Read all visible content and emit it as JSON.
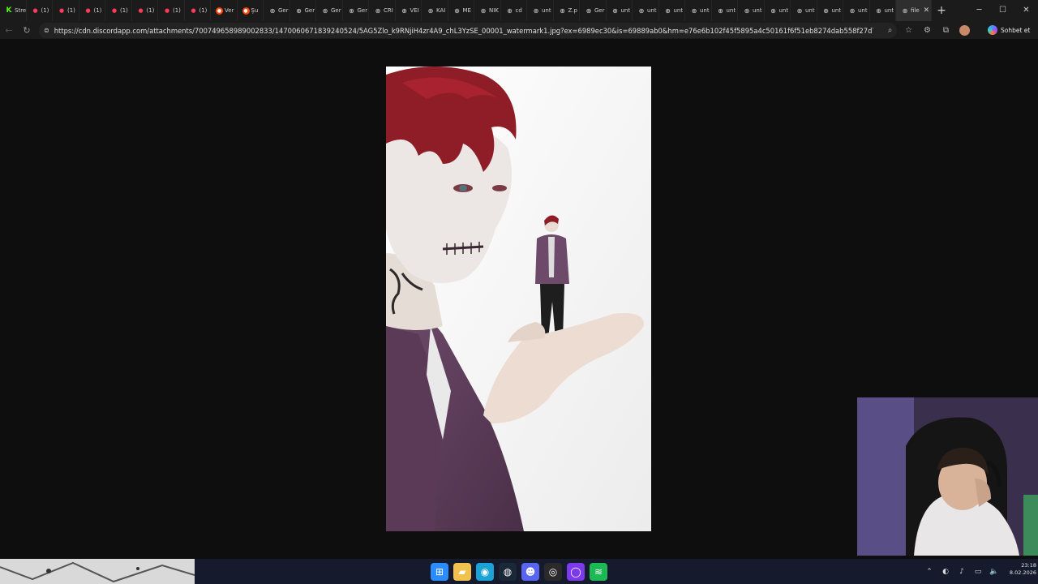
{
  "browser": {
    "tabs": [
      {
        "icon": "kick-icon",
        "label": "Stre"
      },
      {
        "icon": "youtube-icon",
        "label": "(1)"
      },
      {
        "icon": "youtube-icon",
        "label": "(1)"
      },
      {
        "icon": "youtube-icon",
        "label": "(1)"
      },
      {
        "icon": "youtube-icon",
        "label": "(1)"
      },
      {
        "icon": "youtube-icon",
        "label": "(1)"
      },
      {
        "icon": "youtube-icon",
        "label": "(1)"
      },
      {
        "icon": "youtube-icon",
        "label": "(1)"
      },
      {
        "icon": "reddit-icon",
        "label": "Ver"
      },
      {
        "icon": "reddit-icon",
        "label": "Şu"
      },
      {
        "icon": "globe-icon",
        "label": "Ger"
      },
      {
        "icon": "globe-icon",
        "label": "Ger"
      },
      {
        "icon": "globe-icon",
        "label": "Ger"
      },
      {
        "icon": "globe-icon",
        "label": "Ger"
      },
      {
        "icon": "globe-icon",
        "label": "CRI"
      },
      {
        "icon": "globe-icon",
        "label": "VEI"
      },
      {
        "icon": "globe-icon",
        "label": "KAI"
      },
      {
        "icon": "globe-icon",
        "label": "ME"
      },
      {
        "icon": "globe-icon",
        "label": "NIK"
      },
      {
        "icon": "globe-icon",
        "label": "cd"
      },
      {
        "icon": "globe-icon",
        "label": "unt"
      },
      {
        "icon": "globe-icon",
        "label": "Z.p"
      },
      {
        "icon": "globe-icon",
        "label": "Ger"
      },
      {
        "icon": "globe-icon",
        "label": "unt"
      },
      {
        "icon": "globe-icon",
        "label": "unt"
      },
      {
        "icon": "globe-icon",
        "label": "unt"
      },
      {
        "icon": "globe-icon",
        "label": "unt"
      },
      {
        "icon": "globe-icon",
        "label": "unt"
      },
      {
        "icon": "globe-icon",
        "label": "unt"
      },
      {
        "icon": "globe-icon",
        "label": "unt"
      },
      {
        "icon": "globe-icon",
        "label": "unt"
      },
      {
        "icon": "globe-icon",
        "label": "unt"
      },
      {
        "icon": "globe-icon",
        "label": "unt"
      },
      {
        "icon": "globe-icon",
        "label": "unt"
      }
    ],
    "active_tab": {
      "icon": "globe-icon",
      "label": "file"
    },
    "new_tab_label": "+",
    "url": "https://cdn.discordapp.com/attachments/700749658989002833/1470060671839240524/5AG5Zlo_k9RNjiH4zr4A9_chL3YzSE_00001_watermark1.jpg?ex=6989ec30&is=69889ab0&hm=e76e6b102f45f5895a4c50161f6f51eb8274dab558f27d776cbe404192f228e6&",
    "copilot_label": "Sohbet et"
  },
  "taskbar": {
    "apps": [
      {
        "name": "start-icon",
        "color": "#2b8cff"
      },
      {
        "name": "folder-icon",
        "color": "#f2c14e"
      },
      {
        "name": "edge-icon",
        "color": "#1ba3d8"
      },
      {
        "name": "steam-icon",
        "color": "#1b2838"
      },
      {
        "name": "discord-icon",
        "color": "#5865f2"
      },
      {
        "name": "obs-icon",
        "color": "#2a2a2a"
      },
      {
        "name": "app-icon",
        "color": "#7c3aed"
      },
      {
        "name": "spotify-icon",
        "color": "#1db954"
      }
    ],
    "time": "23:18",
    "date": "8.02.2026"
  }
}
